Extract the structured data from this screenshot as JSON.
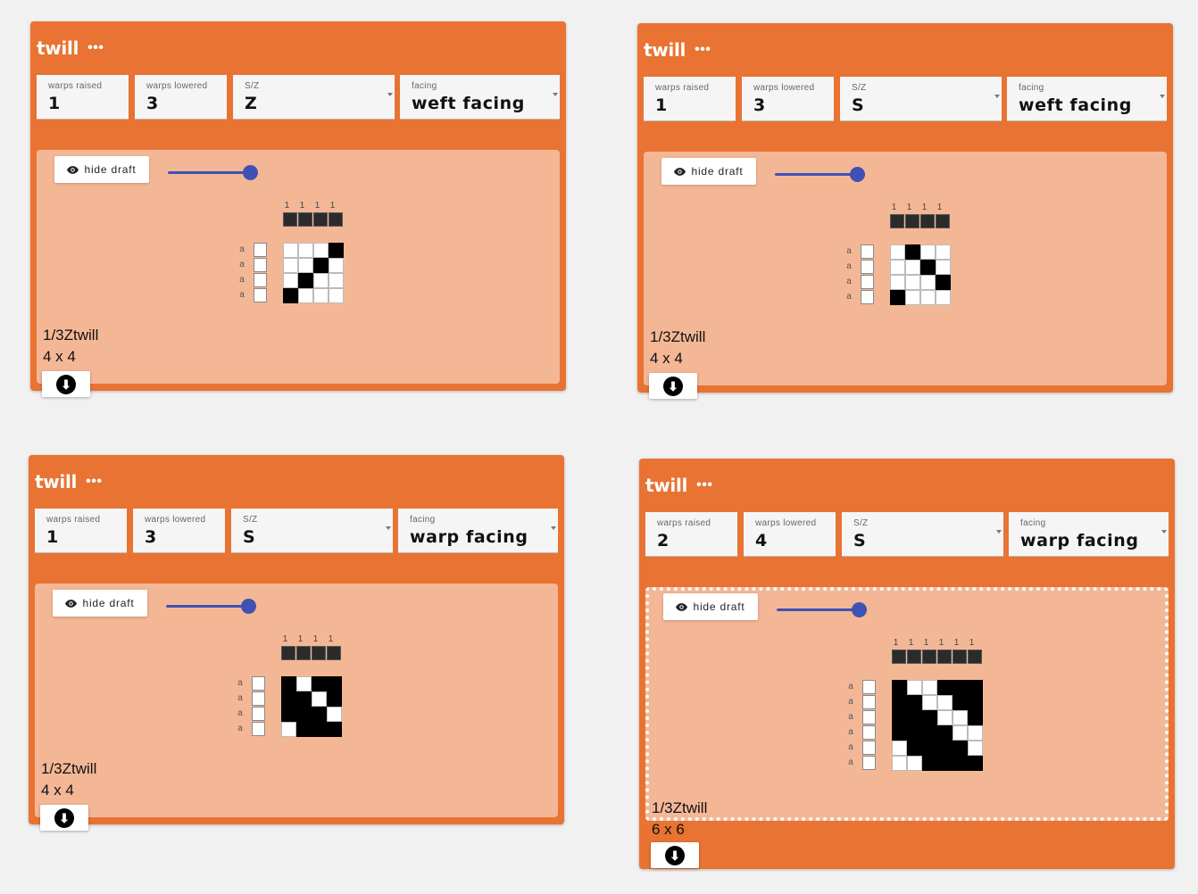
{
  "cards": [
    {
      "title": "twill",
      "menu": "•••",
      "params": [
        {
          "label": "warps raised",
          "value": "1"
        },
        {
          "label": "warps lowered",
          "value": "3"
        },
        {
          "label": "S/Z",
          "value": "Z"
        },
        {
          "label": "facing",
          "value": "weft facing"
        }
      ],
      "hide_draft": "hide draft",
      "tieup_labels": [
        "1",
        "1",
        "1",
        "1"
      ],
      "row_labels": [
        "a",
        "a",
        "a",
        "a"
      ],
      "grid": [
        [
          0,
          0,
          0,
          1
        ],
        [
          0,
          0,
          1,
          0
        ],
        [
          0,
          1,
          0,
          0
        ],
        [
          1,
          0,
          0,
          0
        ]
      ],
      "name": "1/3Ztwill",
      "size": "4 x 4",
      "selected": false
    },
    {
      "title": "twill",
      "menu": "•••",
      "params": [
        {
          "label": "warps raised",
          "value": "1"
        },
        {
          "label": "warps lowered",
          "value": "3"
        },
        {
          "label": "S/Z",
          "value": "S"
        },
        {
          "label": "facing",
          "value": "weft facing"
        }
      ],
      "hide_draft": "hide draft",
      "tieup_labels": [
        "1",
        "1",
        "1",
        "1"
      ],
      "row_labels": [
        "a",
        "a",
        "a",
        "a"
      ],
      "grid": [
        [
          0,
          1,
          0,
          0
        ],
        [
          0,
          0,
          1,
          0
        ],
        [
          0,
          0,
          0,
          1
        ],
        [
          1,
          0,
          0,
          0
        ]
      ],
      "name": "1/3Ztwill",
      "size": "4 x 4",
      "selected": false
    },
    {
      "title": "twill",
      "menu": "•••",
      "params": [
        {
          "label": "warps raised",
          "value": "1"
        },
        {
          "label": "warps lowered",
          "value": "3"
        },
        {
          "label": "S/Z",
          "value": "S"
        },
        {
          "label": "facing",
          "value": "warp facing"
        }
      ],
      "hide_draft": "hide draft",
      "tieup_labels": [
        "1",
        "1",
        "1",
        "1"
      ],
      "row_labels": [
        "a",
        "a",
        "a",
        "a"
      ],
      "grid": [
        [
          1,
          0,
          1,
          1
        ],
        [
          1,
          1,
          0,
          1
        ],
        [
          1,
          1,
          1,
          0
        ],
        [
          0,
          1,
          1,
          1
        ]
      ],
      "name": "1/3Ztwill",
      "size": "4 x 4",
      "selected": false
    },
    {
      "title": "twill",
      "menu": "•••",
      "params": [
        {
          "label": "warps raised",
          "value": "2"
        },
        {
          "label": "warps lowered",
          "value": "4"
        },
        {
          "label": "S/Z",
          "value": "S"
        },
        {
          "label": "facing",
          "value": "warp facing"
        }
      ],
      "hide_draft": "hide draft",
      "tieup_labels": [
        "1",
        "1",
        "1",
        "1",
        "1",
        "1"
      ],
      "row_labels": [
        "a",
        "a",
        "a",
        "a",
        "a",
        "a"
      ],
      "grid": [
        [
          1,
          0,
          0,
          1,
          1,
          1
        ],
        [
          1,
          1,
          0,
          0,
          1,
          1
        ],
        [
          1,
          1,
          1,
          0,
          0,
          1
        ],
        [
          1,
          1,
          1,
          1,
          0,
          0
        ],
        [
          0,
          1,
          1,
          1,
          1,
          0
        ],
        [
          0,
          0,
          1,
          1,
          1,
          1
        ]
      ],
      "name": "1/3Ztwill",
      "size": "6 x 6",
      "selected": true
    }
  ]
}
